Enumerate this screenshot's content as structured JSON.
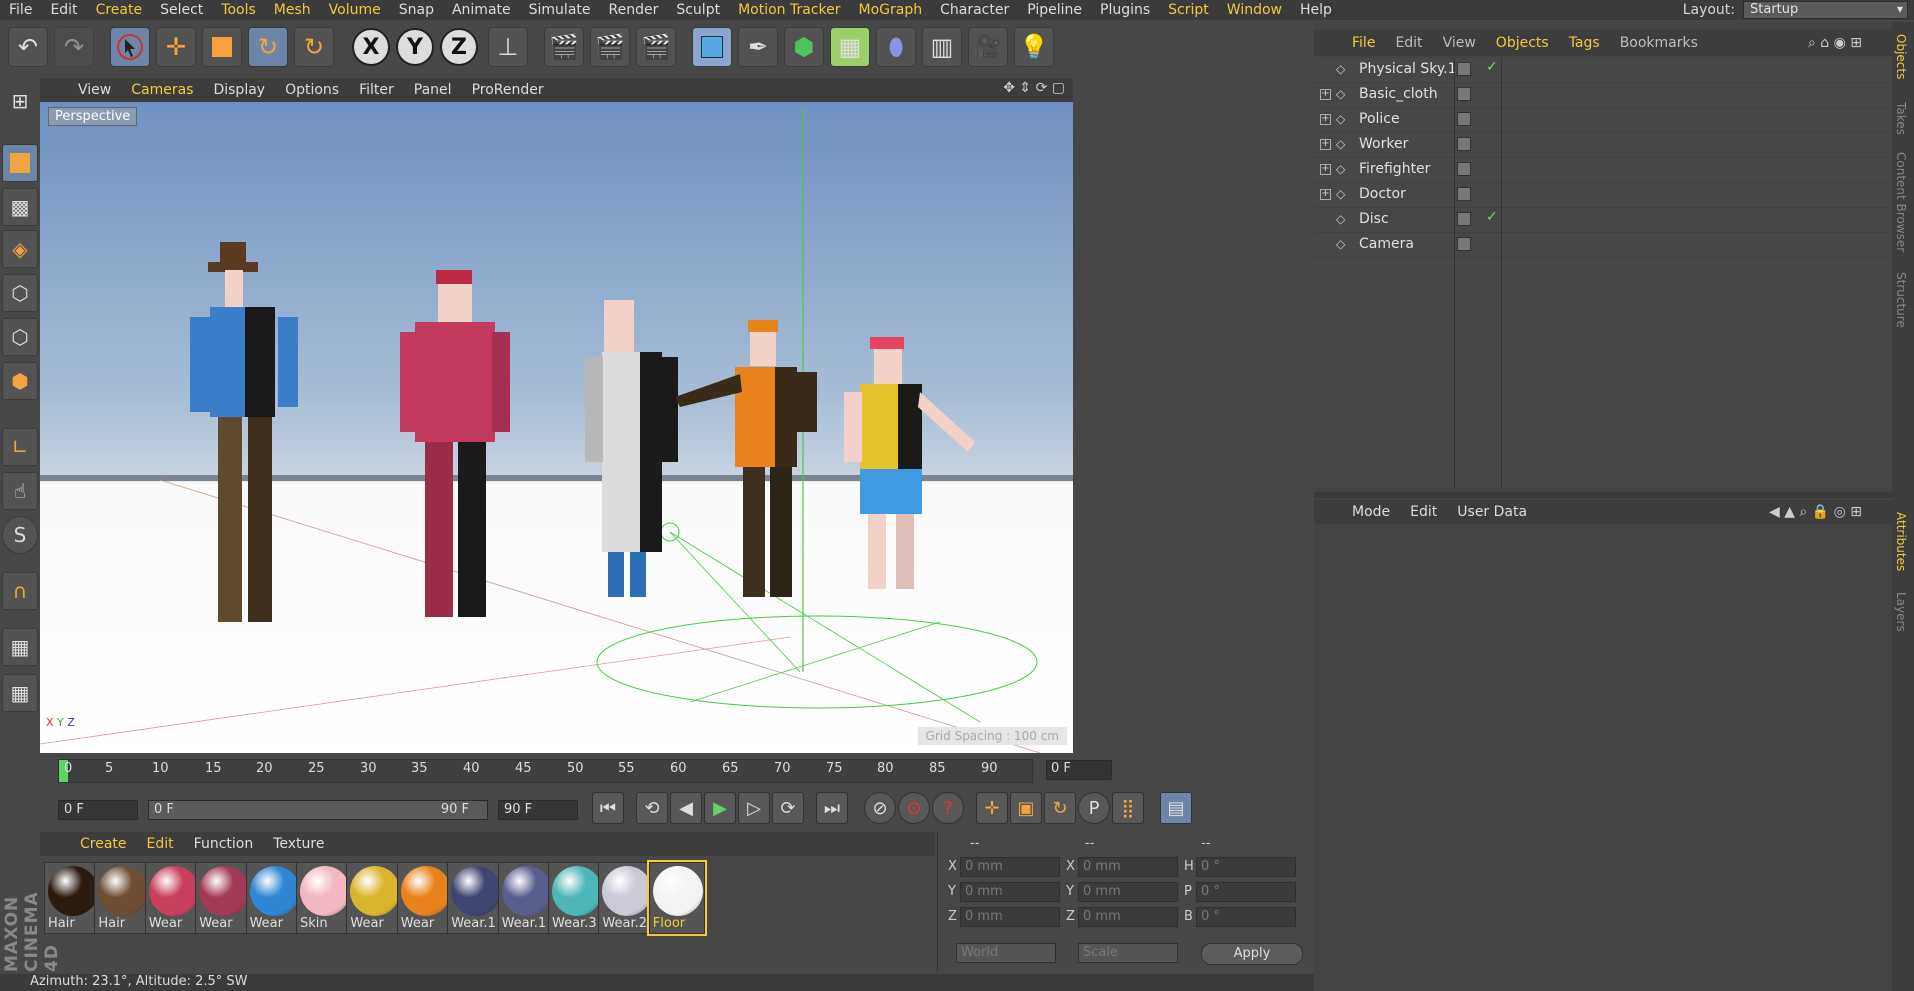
{
  "menubar": {
    "items": [
      {
        "label": "File",
        "hl": false
      },
      {
        "label": "Edit",
        "hl": false
      },
      {
        "label": "Create",
        "hl": true
      },
      {
        "label": "Select",
        "hl": false
      },
      {
        "label": "Tools",
        "hl": true
      },
      {
        "label": "Mesh",
        "hl": true
      },
      {
        "label": "Volume",
        "hl": true
      },
      {
        "label": "Snap",
        "hl": false
      },
      {
        "label": "Animate",
        "hl": false
      },
      {
        "label": "Simulate",
        "hl": false
      },
      {
        "label": "Render",
        "hl": false
      },
      {
        "label": "Sculpt",
        "hl": false
      },
      {
        "label": "Motion Tracker",
        "hl": true
      },
      {
        "label": "MoGraph",
        "hl": true
      },
      {
        "label": "Character",
        "hl": false
      },
      {
        "label": "Pipeline",
        "hl": false
      },
      {
        "label": "Plugins",
        "hl": false
      },
      {
        "label": "Script",
        "hl": true
      },
      {
        "label": "Window",
        "hl": true
      },
      {
        "label": "Help",
        "hl": false
      }
    ],
    "layout_label": "Layout:",
    "layout_value": "Startup"
  },
  "viewport": {
    "menu": [
      "View",
      "Cameras",
      "Display",
      "Options",
      "Filter",
      "Panel",
      "ProRender"
    ],
    "camera_label": "Perspective",
    "grid_spacing": "Grid Spacing : 100 cm",
    "axis_x": "X",
    "axis_y": "Y",
    "axis_z": "Z"
  },
  "timeline": {
    "ticks": [
      "0",
      "5",
      "10",
      "15",
      "20",
      "25",
      "30",
      "35",
      "40",
      "45",
      "50",
      "55",
      "60",
      "65",
      "70",
      "75",
      "80",
      "85",
      "90"
    ],
    "current_frame": "0 F",
    "start_field": "0 F",
    "range_start": "0 F",
    "range_end": "90 F",
    "end_field": "90 F"
  },
  "materials": {
    "menu": [
      "Create",
      "Edit",
      "Function",
      "Texture"
    ],
    "items": [
      {
        "label": "Hair",
        "color": "#2b1a10"
      },
      {
        "label": "Hair",
        "color": "#6e4f34"
      },
      {
        "label": "Wear",
        "color": "#c93e5d"
      },
      {
        "label": "Wear",
        "color": "#a33a55"
      },
      {
        "label": "Wear",
        "color": "#2f86d2"
      },
      {
        "label": "Skin",
        "color": "#f2b7c0"
      },
      {
        "label": "Wear",
        "color": "#d9b52e"
      },
      {
        "label": "Wear",
        "color": "#e8821b"
      },
      {
        "label": "Wear.1",
        "color": "#3f4470"
      },
      {
        "label": "Wear.1",
        "color": "#5a5e8e"
      },
      {
        "label": "Wear.3",
        "color": "#4fb7b8"
      },
      {
        "label": "Wear.2",
        "color": "#c9cad6"
      },
      {
        "label": "Floor",
        "color": "#f3f3f3"
      }
    ]
  },
  "coords": {
    "headers": [
      "--",
      "--",
      "--"
    ],
    "rows": [
      {
        "a": "X",
        "av": "0 mm",
        "b": "X",
        "bv": "0 mm",
        "c": "H",
        "cv": "0 °"
      },
      {
        "a": "Y",
        "av": "0 mm",
        "b": "Y",
        "bv": "0 mm",
        "c": "P",
        "cv": "0 °"
      },
      {
        "a": "Z",
        "av": "0 mm",
        "b": "Z",
        "bv": "0 mm",
        "c": "B",
        "cv": "0 °"
      }
    ],
    "world": "World",
    "scale": "Scale",
    "apply": "Apply"
  },
  "status": "Azimuth: 23.1°, Altitude: 2.5° SW",
  "brand": "MAXON CINEMA 4D",
  "objects": {
    "menu": [
      {
        "label": "File",
        "hl": true
      },
      {
        "label": "Edit",
        "hl": false
      },
      {
        "label": "View",
        "hl": false
      },
      {
        "label": "Objects",
        "hl": true
      },
      {
        "label": "Tags",
        "hl": true
      },
      {
        "label": "Bookmarks",
        "hl": false
      }
    ],
    "rows": [
      {
        "name": "Physical Sky.1",
        "expand": "",
        "check": "✓"
      },
      {
        "name": "Basic_cloth",
        "expand": "+",
        "check": ""
      },
      {
        "name": "Police",
        "expand": "+",
        "check": ""
      },
      {
        "name": "Worker",
        "expand": "+",
        "check": ""
      },
      {
        "name": "Firefighter",
        "expand": "+",
        "check": ""
      },
      {
        "name": "Doctor",
        "expand": "+",
        "check": ""
      },
      {
        "name": "Disc",
        "expand": "",
        "check": "✓"
      },
      {
        "name": "Camera",
        "expand": "",
        "check": ""
      }
    ]
  },
  "attributes": {
    "menu": [
      "Mode",
      "Edit",
      "User Data"
    ]
  },
  "sidetabs": [
    "Objects",
    "Takes",
    "Content Browser",
    "Structure",
    "Attributes",
    "Layers"
  ]
}
